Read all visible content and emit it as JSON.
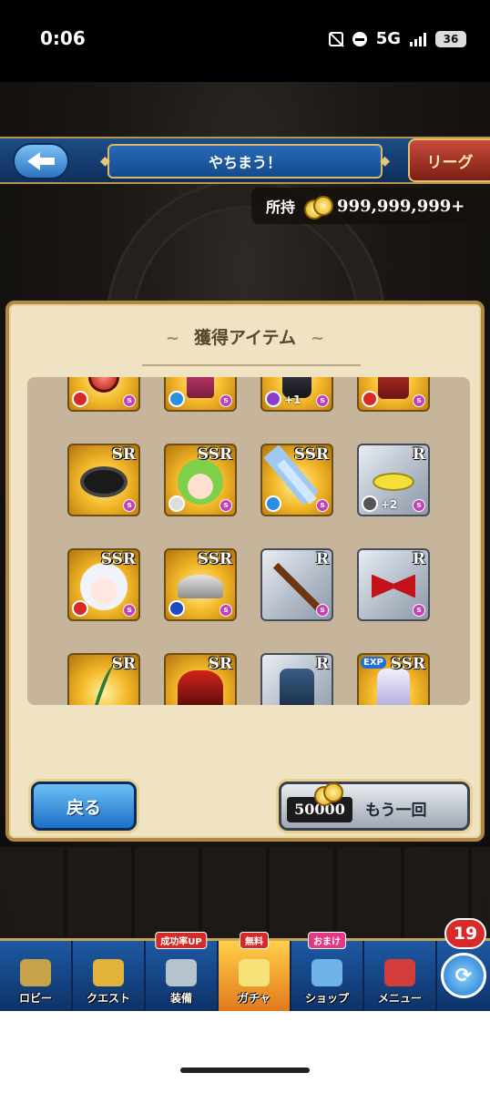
{
  "status_bar": {
    "time": "0:06",
    "network": "5G",
    "battery": "36"
  },
  "header": {
    "title": "やちまう！",
    "league_label": "リーグ"
  },
  "currency": {
    "label": "所持",
    "amount": "999,999,999+"
  },
  "panel": {
    "title": "獲得アイテム",
    "items": [
      {
        "rarity": "",
        "tone": "gold",
        "element": "red",
        "plus": "",
        "art": "red-orb"
      },
      {
        "rarity": "",
        "tone": "gold",
        "element": "blue",
        "plus": "",
        "art": "pink-armor"
      },
      {
        "rarity": "",
        "tone": "gold",
        "element": "purple",
        "plus": "+1",
        "art": "dark-armor"
      },
      {
        "rarity": "",
        "tone": "gold",
        "element": "red",
        "plus": "",
        "art": "red-coat"
      },
      {
        "rarity": "SR",
        "tone": "gold",
        "element": "",
        "plus": "",
        "art": "black-ring"
      },
      {
        "rarity": "SSR",
        "tone": "gold",
        "element": "green",
        "plus": "",
        "art": "flower-girl"
      },
      {
        "rarity": "SSR",
        "tone": "gold",
        "element": "blue",
        "plus": "",
        "art": "hammer"
      },
      {
        "rarity": "R",
        "tone": "silver",
        "element": "grey",
        "plus": "+2",
        "art": "yellow-ribbon"
      },
      {
        "rarity": "SSR",
        "tone": "gold",
        "element": "red",
        "plus": "",
        "art": "white-hair-girl"
      },
      {
        "rarity": "SSR",
        "tone": "gold",
        "element": "dblue",
        "plus": "",
        "art": "silver-wing"
      },
      {
        "rarity": "R",
        "tone": "silver",
        "element": "",
        "plus": "",
        "art": "wood-staff"
      },
      {
        "rarity": "R",
        "tone": "silver",
        "element": "",
        "plus": "",
        "art": "red-bow"
      },
      {
        "rarity": "SR",
        "tone": "gold",
        "element": "",
        "plus": "",
        "art": "green-bow"
      },
      {
        "rarity": "SR",
        "tone": "gold",
        "element": "",
        "plus": "",
        "art": "red-dragon"
      },
      {
        "rarity": "R",
        "tone": "silver",
        "element": "",
        "plus": "",
        "art": "blue-jacket"
      },
      {
        "rarity": "SSR",
        "tone": "gold",
        "element": "",
        "plus": "",
        "art": "white-armor",
        "exp": "EXP"
      }
    ],
    "back_label": "戻る",
    "again_cost": "50000",
    "again_label": "もう一回"
  },
  "bottom_nav": {
    "items": [
      {
        "label": "ロビー",
        "tag": "",
        "icon": "lobby-icon"
      },
      {
        "label": "クエスト",
        "tag": "",
        "icon": "quest-icon"
      },
      {
        "label": "装備",
        "tag": "成功率UP",
        "icon": "equipment-icon"
      },
      {
        "label": "ガチャ",
        "tag": "無料",
        "icon": "gacha-icon"
      },
      {
        "label": "ショップ",
        "tag": "おまけ",
        "icon": "shop-icon"
      },
      {
        "label": "メニュー",
        "tag": "",
        "icon": "menu-icon"
      }
    ],
    "badge_count": "19"
  },
  "colors": {
    "header_blue": "#1c4d86",
    "gold_trim": "#b79549",
    "panel_bg": "#efe3c3",
    "active_tab": "#f0a330"
  }
}
